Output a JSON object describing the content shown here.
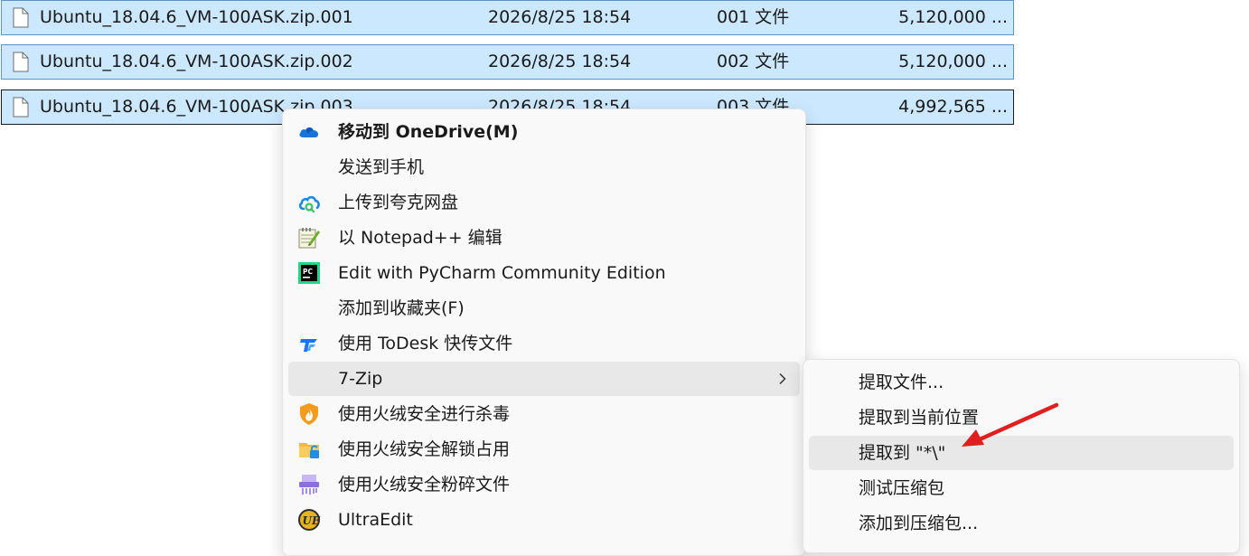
{
  "files": [
    {
      "name": "Ubuntu_18.04.6_VM-100ASK.zip.001",
      "date": "2026/8/25 18:54",
      "type": "001 文件",
      "size": "5,120,000 ..."
    },
    {
      "name": "Ubuntu_18.04.6_VM-100ASK.zip.002",
      "date": "2026/8/25 18:54",
      "type": "002 文件",
      "size": "5,120,000 ..."
    },
    {
      "name": "Ubuntu_18.04.6_VM-100ASK.zip.003",
      "date": "2026/8/25 18:54",
      "type": "003 文件",
      "size": "4,992,565 ..."
    }
  ],
  "context_menu": {
    "items": [
      {
        "label": "移动到 OneDrive(M)",
        "icon": "onedrive-icon"
      },
      {
        "label": "发送到手机",
        "icon": ""
      },
      {
        "label": "上传到夸克网盘",
        "icon": "quark-cloud-icon"
      },
      {
        "label": "以 Notepad++ 编辑",
        "icon": "notepad-plus-plus-icon"
      },
      {
        "label": "Edit with PyCharm Community Edition",
        "icon": "pycharm-icon"
      },
      {
        "label": "添加到收藏夹(F)",
        "icon": ""
      },
      {
        "label": "使用 ToDesk 快传文件",
        "icon": "todesk-icon"
      },
      {
        "label": "7-Zip",
        "icon": "chevron-right-icon"
      },
      {
        "label": "使用火绒安全进行杀毒",
        "icon": "huorong-shield-icon"
      },
      {
        "label": "使用火绒安全解锁占用",
        "icon": "folder-unlock-icon"
      },
      {
        "label": "使用火绒安全粉碎文件",
        "icon": "shredder-icon"
      },
      {
        "label": "UltraEdit",
        "icon": "ultraedit-icon"
      }
    ]
  },
  "submenu_7zip": {
    "items": [
      {
        "label": "提取文件..."
      },
      {
        "label": "提取到当前位置"
      },
      {
        "label": "提取到 \"*\\\""
      },
      {
        "label": "测试压缩包"
      },
      {
        "label": "添加到压缩包..."
      }
    ]
  },
  "colors": {
    "selection_bg": "#cce8ff",
    "selection_border": "#5f94c6",
    "menu_bg": "#f9f9f9",
    "menu_highlight": "#e8e8e8",
    "arrow": "#e0201f"
  }
}
